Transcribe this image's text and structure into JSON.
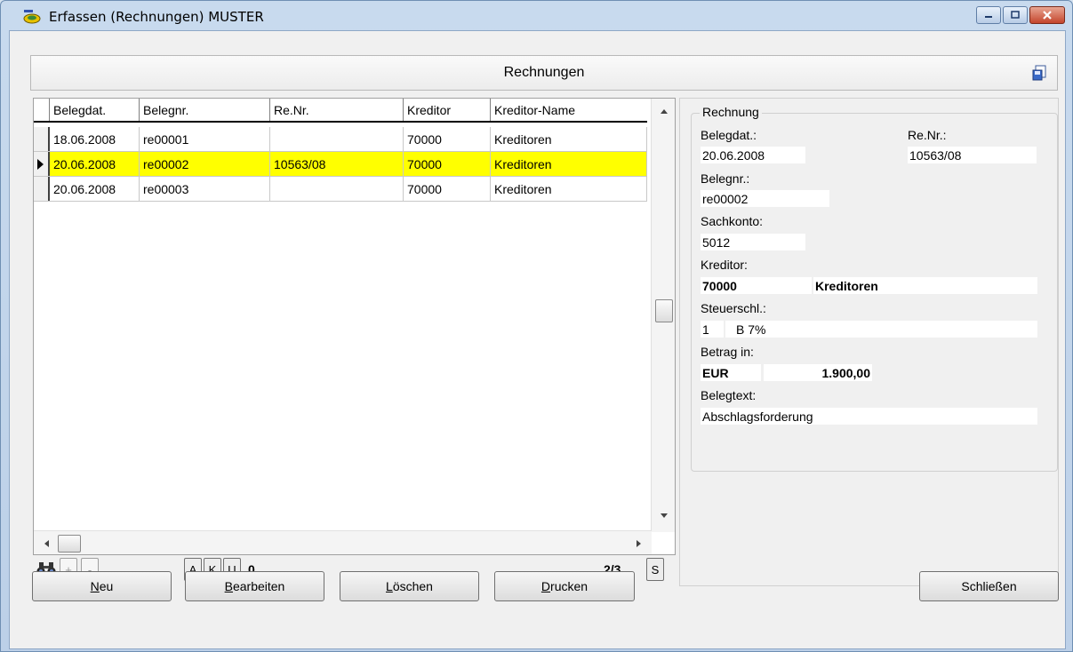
{
  "window": {
    "title": "Erfassen (Rechnungen) MUSTER",
    "controls": [
      "minimize",
      "maximize",
      "close"
    ]
  },
  "header": {
    "title": "Rechnungen",
    "icon": "save-icon"
  },
  "grid": {
    "columns": [
      "Belegdat.",
      "Belegnr.",
      "Re.Nr.",
      "Kreditor",
      "Kreditor-Name"
    ],
    "rows": [
      {
        "belegdat": "18.06.2008",
        "belegnr": "re00001",
        "renr": "",
        "kreditor": "70000",
        "name": "Kreditoren",
        "selected": false
      },
      {
        "belegdat": "20.06.2008",
        "belegnr": "re00002",
        "renr": "10563/08",
        "kreditor": "70000",
        "name": "Kreditoren",
        "selected": true
      },
      {
        "belegdat": "20.06.2008",
        "belegnr": "re00003",
        "renr": "",
        "kreditor": "70000",
        "name": "Kreditoren",
        "selected": false
      }
    ],
    "selected_color": "#ffff00"
  },
  "navbar": {
    "search_icon": "binoculars-icon",
    "plus": "+",
    "minus": "-",
    "btn_a": "A",
    "btn_k": "K",
    "btn_u": "U",
    "count": "0",
    "position": "2/3",
    "btn_s": "S"
  },
  "detail": {
    "group_title": "Rechnung",
    "belegdat_label": "Belegdat.:",
    "belegdat_value": "20.06.2008",
    "renr_label": "Re.Nr.:",
    "renr_value": "10563/08",
    "belegnr_label": "Belegnr.:",
    "belegnr_value": "re00002",
    "sachkonto_label": "Sachkonto:",
    "sachkonto_value": "5012",
    "kreditor_label": "Kreditor:",
    "kreditor_nr": "70000",
    "kreditor_name": "Kreditoren",
    "steuer_label": "Steuerschl.:",
    "steuer_nr": "1",
    "steuer_text": "B 7%",
    "betrag_label": "Betrag in:",
    "betrag_currency": "EUR",
    "betrag_value": "1.900,00",
    "belegtext_label": "Belegtext:",
    "belegtext_value": "Abschlagsforderung"
  },
  "buttons": {
    "neu_first": "N",
    "neu_rest": "eu",
    "bearbeiten_first": "B",
    "bearbeiten_rest": "earbeiten",
    "loeschen_first": "L",
    "loeschen_rest": "öschen",
    "drucken_first": "D",
    "drucken_rest": "rucken",
    "schliessen": "Schließen"
  }
}
